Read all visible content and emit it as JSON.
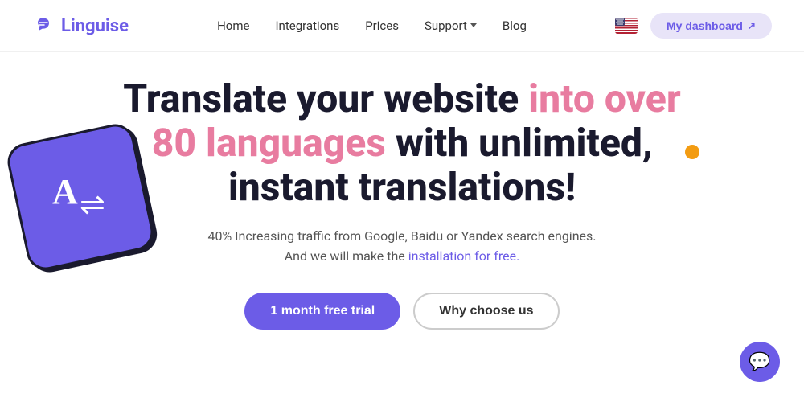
{
  "logo": {
    "text": "Linguise",
    "icon_label": "linguise-logo-icon"
  },
  "nav": {
    "links": [
      {
        "label": "Home",
        "has_dropdown": false
      },
      {
        "label": "Integrations",
        "has_dropdown": false
      },
      {
        "label": "Prices",
        "has_dropdown": false
      },
      {
        "label": "Support",
        "has_dropdown": true
      },
      {
        "label": "Blog",
        "has_dropdown": false
      }
    ],
    "dashboard_button": "My dashboard",
    "flag_alt": "US English flag"
  },
  "hero": {
    "title_part1": "Translate your website ",
    "title_highlight": "into over 80 languages",
    "title_part2": " with unlimited, instant translations!",
    "subtitle_line1": "40% Increasing traffic from Google, Baidu or Yandex search engines.",
    "subtitle_line2": "And we will make the ",
    "subtitle_link": "installation for free.",
    "btn_primary": "1 month free trial",
    "btn_secondary": "Why choose us"
  },
  "decorations": {
    "orange_dot": true,
    "translate_card_char": "A"
  },
  "chat_fab": {
    "icon": "💬"
  }
}
